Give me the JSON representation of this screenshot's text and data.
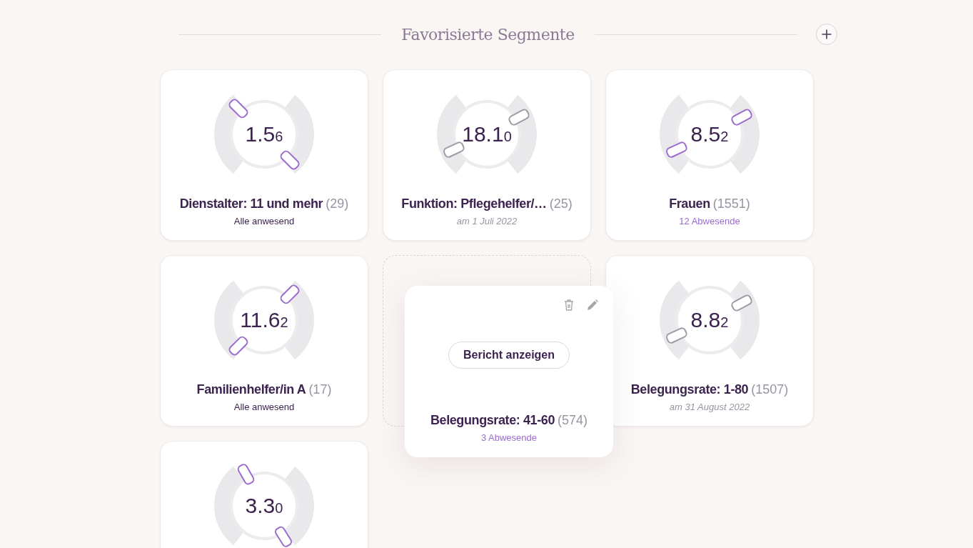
{
  "header": {
    "title": "Favorisierte Segmente"
  },
  "segments": [
    {
      "kind": "gauge",
      "value": "1.5",
      "value_small": "6",
      "gauge": {
        "kind": "falling",
        "markers": [
          {
            "color": "#9b6bd0"
          },
          {
            "color": "#9b6bd0"
          }
        ]
      },
      "title": "Dienstalter: 11 und mehr",
      "count": "(29)",
      "subtitle": {
        "text": "Alle anwesend",
        "kind": "present"
      }
    },
    {
      "kind": "gauge",
      "value": "18.1",
      "value_small": "0",
      "gauge": {
        "kind": "rising",
        "markers": [
          {
            "color": "#a09aa6"
          },
          {
            "color": "#a09aa6"
          }
        ]
      },
      "title": "Funktion: Pflegehelfer/…",
      "count": "(25)",
      "subtitle": {
        "text": "am 1 Juli 2022",
        "kind": "date"
      }
    },
    {
      "kind": "gauge",
      "value": "8.5",
      "value_small": "2",
      "gauge": {
        "kind": "rising",
        "markers": [
          {
            "color": "#9b6bd0"
          },
          {
            "color": "#9b6bd0"
          }
        ]
      },
      "title": "Frauen",
      "count": "(1551)",
      "subtitle": {
        "text": "12 Abwesende",
        "kind": "absent"
      }
    },
    {
      "kind": "gauge",
      "value": "11.6",
      "value_small": "2",
      "gauge": {
        "kind": "diagonal",
        "markers": [
          {
            "color": "#9b6bd0"
          },
          {
            "color": "#9b6bd0"
          }
        ]
      },
      "title": "Familienhelfer/in A",
      "count": "(17)",
      "subtitle": {
        "text": "Alle anwesend",
        "kind": "present"
      }
    },
    {
      "kind": "hover",
      "button": "Bericht anzeigen",
      "title": "Belegungsrate: 41-60",
      "count": "(574)",
      "subtitle": {
        "text": "3 Abwesende",
        "kind": "absent"
      }
    },
    {
      "kind": "gauge",
      "value": "8.8",
      "value_small": "2",
      "gauge": {
        "kind": "rising",
        "markers": [
          {
            "color": "#a09aa6"
          },
          {
            "color": "#a09aa6"
          }
        ]
      },
      "title": "Belegungsrate: 1-80",
      "count": "(1507)",
      "subtitle": {
        "text": "am 31 August 2022",
        "kind": "date"
      }
    },
    {
      "kind": "gauge",
      "value": "3.3",
      "value_small": "0",
      "gauge": {
        "kind": "steep",
        "markers": [
          {
            "color": "#9b6bd0"
          },
          {
            "color": "#9b6bd0"
          }
        ]
      }
    }
  ]
}
